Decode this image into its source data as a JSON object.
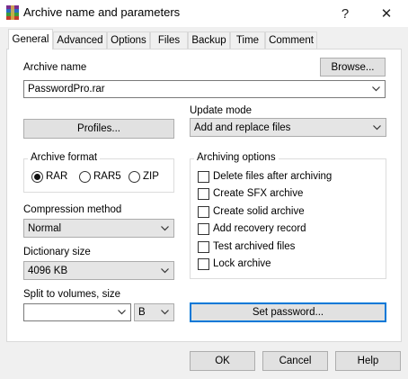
{
  "window": {
    "title": "Archive name and parameters",
    "help_glyph": "?",
    "close_glyph": "✕"
  },
  "tabs": [
    {
      "label": "General",
      "active": true
    },
    {
      "label": "Advanced"
    },
    {
      "label": "Options"
    },
    {
      "label": "Files"
    },
    {
      "label": "Backup"
    },
    {
      "label": "Time"
    },
    {
      "label": "Comment"
    }
  ],
  "general": {
    "archive_name_label": "Archive name",
    "browse_label": "Browse...",
    "archive_name_value": "PasswordPro.rar",
    "profiles_label": "Profiles...",
    "update_mode_label": "Update mode",
    "update_mode_value": "Add and replace files",
    "archive_format": {
      "title": "Archive format",
      "options": [
        "RAR",
        "RAR5",
        "ZIP"
      ],
      "selected": "RAR"
    },
    "archiving_options": {
      "title": "Archiving options",
      "items": [
        "Delete files after archiving",
        "Create SFX archive",
        "Create solid archive",
        "Add recovery record",
        "Test archived files",
        "Lock archive"
      ]
    },
    "compression_method_label": "Compression method",
    "compression_method_value": "Normal",
    "dictionary_size_label": "Dictionary size",
    "dictionary_size_value": "4096 KB",
    "split_label": "Split to volumes, size",
    "split_value": "",
    "split_unit": "B",
    "set_password_label": "Set password..."
  },
  "footer": {
    "ok_label": "OK",
    "cancel_label": "Cancel",
    "help_label": "Help"
  },
  "colors": {
    "focus_border": "#0078d7",
    "button_face": "#e1e1e1",
    "dialog_bg": "#f0f0f0"
  }
}
